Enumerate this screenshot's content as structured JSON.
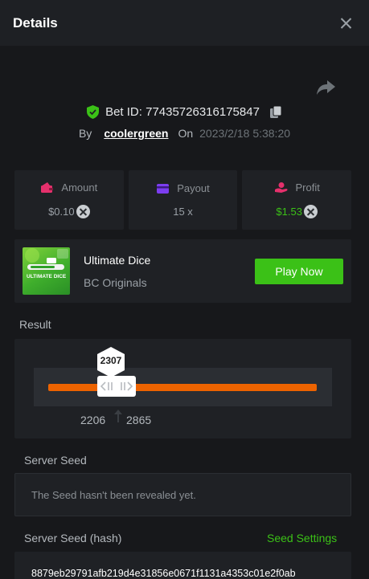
{
  "header": {
    "title": "Details",
    "close_icon": "close-icon"
  },
  "share_icon": "share-icon",
  "bet": {
    "id_label": "Bet ID: 77435726316175847",
    "shield_icon": "shield-check-icon",
    "copy_icon": "copy-icon"
  },
  "byline": {
    "by_label": "By",
    "username": "coolergreen",
    "on_label": "On",
    "date": "2023/2/18 5:38:20"
  },
  "stats": [
    {
      "label": "Amount",
      "value": "$0.10",
      "icon": "wallet-icon",
      "icon_color": "#e5306c",
      "value_color": "#9aa0a6"
    },
    {
      "label": "Payout",
      "value": "15 x",
      "icon": "card-icon",
      "icon_color": "#7c3df0",
      "value_color": "#9aa0a6"
    },
    {
      "label": "Profit",
      "value": "$1.53",
      "icon": "hand-coin-icon",
      "icon_color": "#e5306c",
      "value_color": "#3bc117"
    }
  ],
  "game": {
    "name": "Ultimate Dice",
    "provider": "BC Originals",
    "thumbnail_text": "ULTIMATE DICE",
    "play_label": "Play Now"
  },
  "result": {
    "label": "Result",
    "value": "2307",
    "range_low": "2206",
    "range_high": "2865",
    "bar_color": "#ed6300"
  },
  "server_seed": {
    "label": "Server Seed",
    "text": "The Seed hasn't been revealed yet."
  },
  "server_seed_hash": {
    "label": "Server Seed (hash)",
    "settings_label": "Seed Settings",
    "value": "8879eb29791afb219d4e31856e0671f1131a4353c01e2f0ab"
  },
  "colors": {
    "accent_green": "#3bc117",
    "background": "#17181b",
    "panel": "#1f2125"
  }
}
